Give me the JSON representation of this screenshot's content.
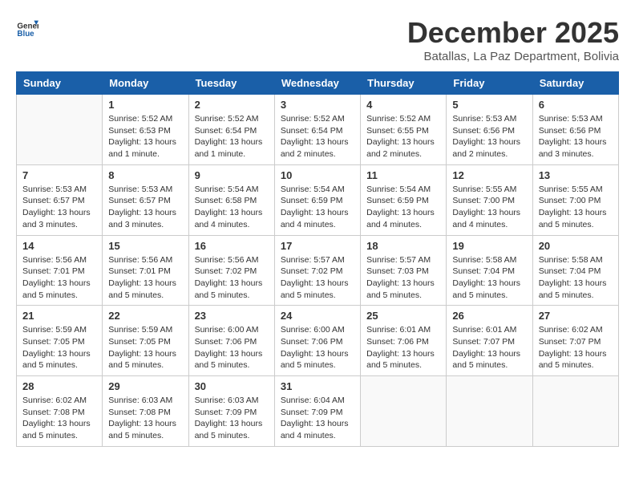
{
  "logo": {
    "general": "General",
    "blue": "Blue"
  },
  "title": {
    "month_year": "December 2025",
    "location": "Batallas, La Paz Department, Bolivia"
  },
  "weekdays": [
    "Sunday",
    "Monday",
    "Tuesday",
    "Wednesday",
    "Thursday",
    "Friday",
    "Saturday"
  ],
  "weeks": [
    [
      {
        "day": "",
        "info": ""
      },
      {
        "day": "1",
        "info": "Sunrise: 5:52 AM\nSunset: 6:53 PM\nDaylight: 13 hours\nand 1 minute."
      },
      {
        "day": "2",
        "info": "Sunrise: 5:52 AM\nSunset: 6:54 PM\nDaylight: 13 hours\nand 1 minute."
      },
      {
        "day": "3",
        "info": "Sunrise: 5:52 AM\nSunset: 6:54 PM\nDaylight: 13 hours\nand 2 minutes."
      },
      {
        "day": "4",
        "info": "Sunrise: 5:52 AM\nSunset: 6:55 PM\nDaylight: 13 hours\nand 2 minutes."
      },
      {
        "day": "5",
        "info": "Sunrise: 5:53 AM\nSunset: 6:56 PM\nDaylight: 13 hours\nand 2 minutes."
      },
      {
        "day": "6",
        "info": "Sunrise: 5:53 AM\nSunset: 6:56 PM\nDaylight: 13 hours\nand 3 minutes."
      }
    ],
    [
      {
        "day": "7",
        "info": "Sunrise: 5:53 AM\nSunset: 6:57 PM\nDaylight: 13 hours\nand 3 minutes."
      },
      {
        "day": "8",
        "info": "Sunrise: 5:53 AM\nSunset: 6:57 PM\nDaylight: 13 hours\nand 3 minutes."
      },
      {
        "day": "9",
        "info": "Sunrise: 5:54 AM\nSunset: 6:58 PM\nDaylight: 13 hours\nand 4 minutes."
      },
      {
        "day": "10",
        "info": "Sunrise: 5:54 AM\nSunset: 6:59 PM\nDaylight: 13 hours\nand 4 minutes."
      },
      {
        "day": "11",
        "info": "Sunrise: 5:54 AM\nSunset: 6:59 PM\nDaylight: 13 hours\nand 4 minutes."
      },
      {
        "day": "12",
        "info": "Sunrise: 5:55 AM\nSunset: 7:00 PM\nDaylight: 13 hours\nand 4 minutes."
      },
      {
        "day": "13",
        "info": "Sunrise: 5:55 AM\nSunset: 7:00 PM\nDaylight: 13 hours\nand 5 minutes."
      }
    ],
    [
      {
        "day": "14",
        "info": "Sunrise: 5:56 AM\nSunset: 7:01 PM\nDaylight: 13 hours\nand 5 minutes."
      },
      {
        "day": "15",
        "info": "Sunrise: 5:56 AM\nSunset: 7:01 PM\nDaylight: 13 hours\nand 5 minutes."
      },
      {
        "day": "16",
        "info": "Sunrise: 5:56 AM\nSunset: 7:02 PM\nDaylight: 13 hours\nand 5 minutes."
      },
      {
        "day": "17",
        "info": "Sunrise: 5:57 AM\nSunset: 7:02 PM\nDaylight: 13 hours\nand 5 minutes."
      },
      {
        "day": "18",
        "info": "Sunrise: 5:57 AM\nSunset: 7:03 PM\nDaylight: 13 hours\nand 5 minutes."
      },
      {
        "day": "19",
        "info": "Sunrise: 5:58 AM\nSunset: 7:04 PM\nDaylight: 13 hours\nand 5 minutes."
      },
      {
        "day": "20",
        "info": "Sunrise: 5:58 AM\nSunset: 7:04 PM\nDaylight: 13 hours\nand 5 minutes."
      }
    ],
    [
      {
        "day": "21",
        "info": "Sunrise: 5:59 AM\nSunset: 7:05 PM\nDaylight: 13 hours\nand 5 minutes."
      },
      {
        "day": "22",
        "info": "Sunrise: 5:59 AM\nSunset: 7:05 PM\nDaylight: 13 hours\nand 5 minutes."
      },
      {
        "day": "23",
        "info": "Sunrise: 6:00 AM\nSunset: 7:06 PM\nDaylight: 13 hours\nand 5 minutes."
      },
      {
        "day": "24",
        "info": "Sunrise: 6:00 AM\nSunset: 7:06 PM\nDaylight: 13 hours\nand 5 minutes."
      },
      {
        "day": "25",
        "info": "Sunrise: 6:01 AM\nSunset: 7:06 PM\nDaylight: 13 hours\nand 5 minutes."
      },
      {
        "day": "26",
        "info": "Sunrise: 6:01 AM\nSunset: 7:07 PM\nDaylight: 13 hours\nand 5 minutes."
      },
      {
        "day": "27",
        "info": "Sunrise: 6:02 AM\nSunset: 7:07 PM\nDaylight: 13 hours\nand 5 minutes."
      }
    ],
    [
      {
        "day": "28",
        "info": "Sunrise: 6:02 AM\nSunset: 7:08 PM\nDaylight: 13 hours\nand 5 minutes."
      },
      {
        "day": "29",
        "info": "Sunrise: 6:03 AM\nSunset: 7:08 PM\nDaylight: 13 hours\nand 5 minutes."
      },
      {
        "day": "30",
        "info": "Sunrise: 6:03 AM\nSunset: 7:09 PM\nDaylight: 13 hours\nand 5 minutes."
      },
      {
        "day": "31",
        "info": "Sunrise: 6:04 AM\nSunset: 7:09 PM\nDaylight: 13 hours\nand 4 minutes."
      },
      {
        "day": "",
        "info": ""
      },
      {
        "day": "",
        "info": ""
      },
      {
        "day": "",
        "info": ""
      }
    ]
  ]
}
